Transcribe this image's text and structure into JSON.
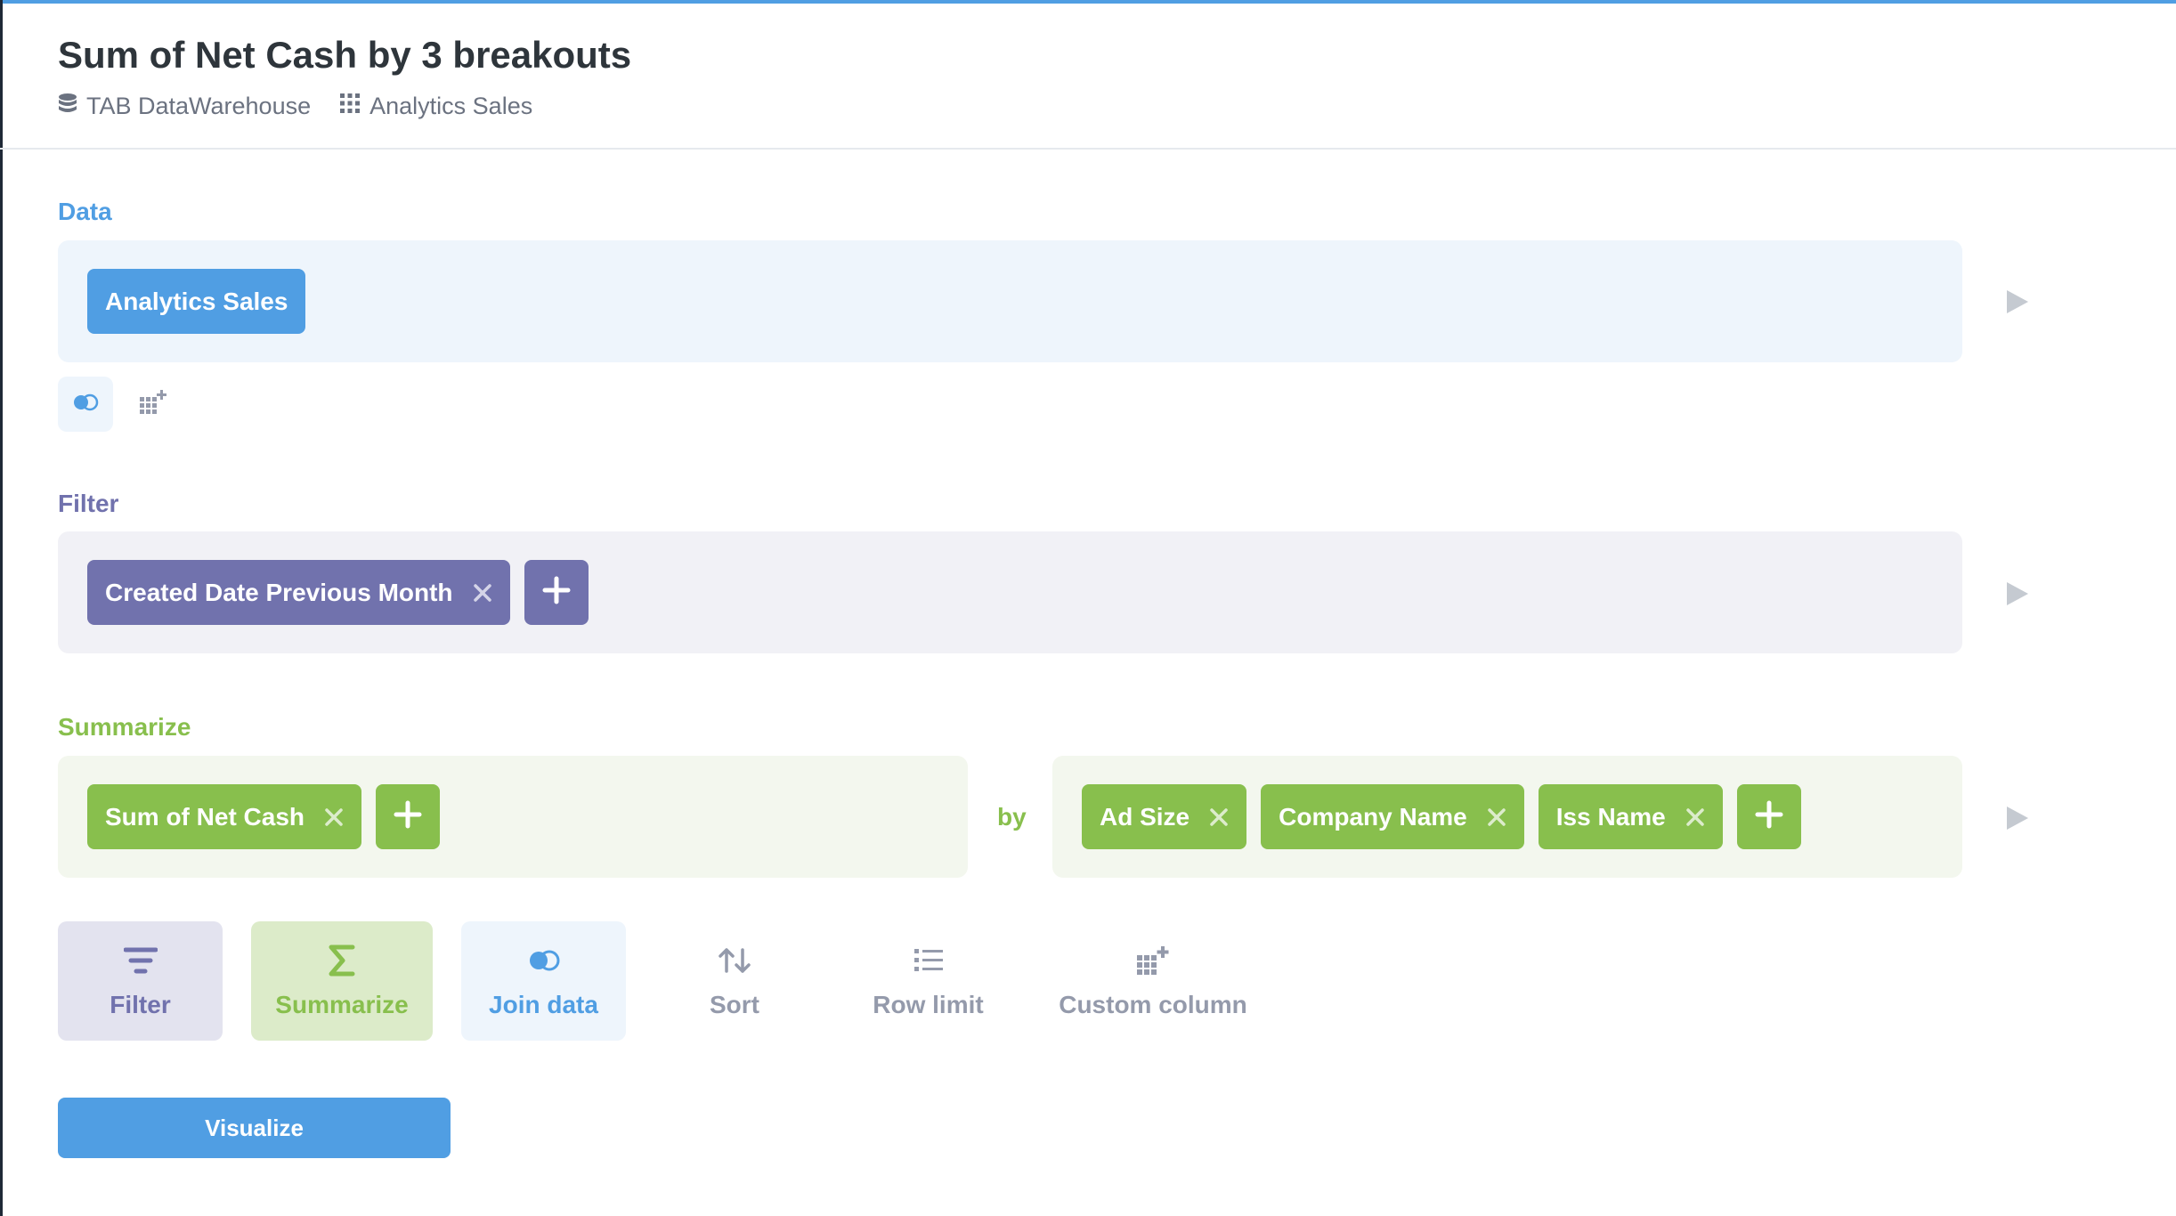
{
  "header": {
    "title": "Sum of Net Cash by 3 breakouts",
    "database": "TAB DataWarehouse",
    "table": "Analytics Sales"
  },
  "data_section": {
    "label": "Data",
    "source": "Analytics Sales"
  },
  "filter_section": {
    "label": "Filter",
    "filters": [
      "Created Date Previous Month"
    ]
  },
  "summarize_section": {
    "label": "Summarize",
    "metrics": [
      "Sum of Net Cash"
    ],
    "by_label": "by",
    "breakouts": [
      "Ad Size",
      "Company Name",
      "Iss Name"
    ]
  },
  "actions": {
    "filter": "Filter",
    "summarize": "Summarize",
    "join": "Join data",
    "sort": "Sort",
    "row_limit": "Row limit",
    "custom_column": "Custom column"
  },
  "visualize_label": "Visualize",
  "colors": {
    "data": "#509ee3",
    "filter": "#7172ad",
    "summarize": "#88bf4d"
  }
}
